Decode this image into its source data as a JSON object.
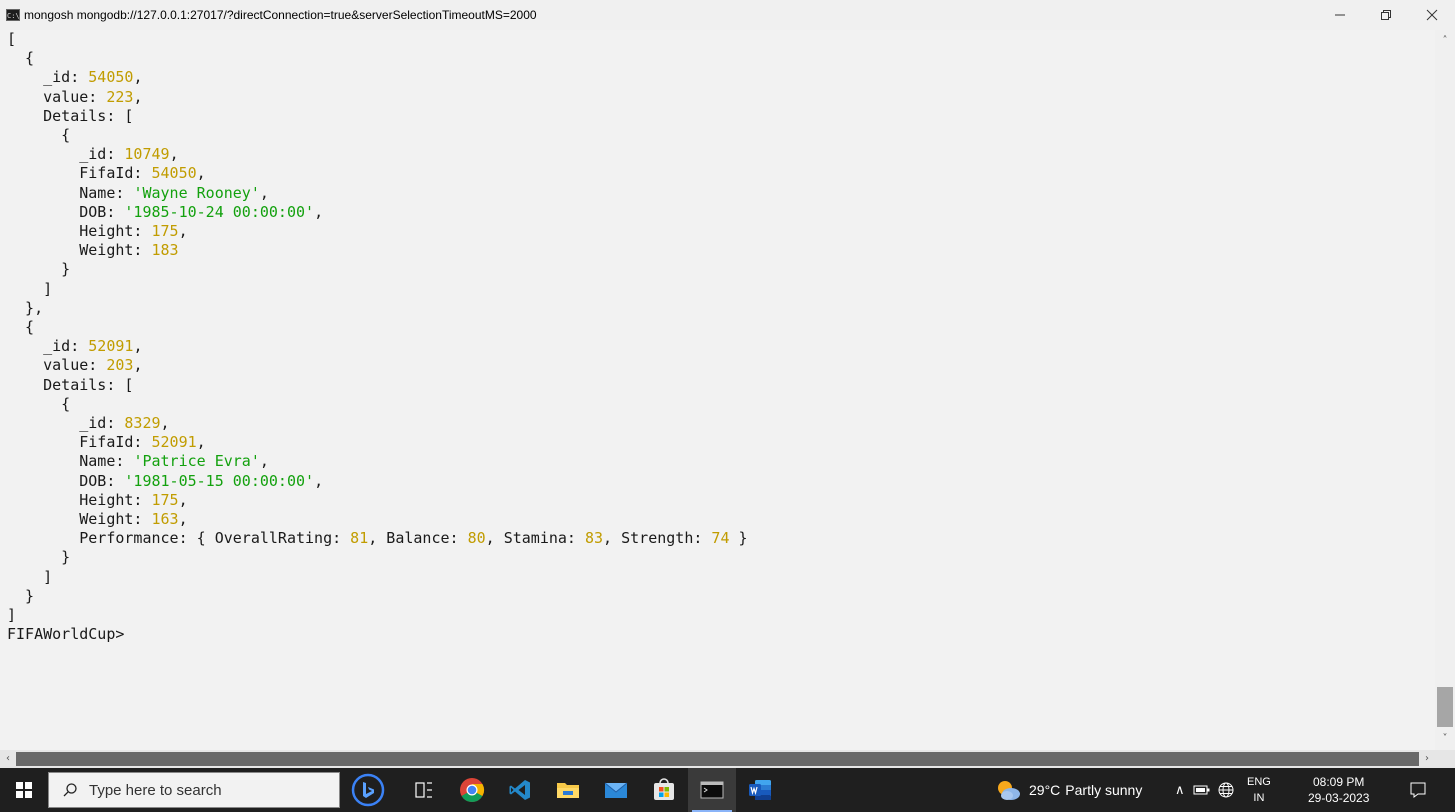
{
  "window": {
    "title": "mongosh mongodb://127.0.0.1:27017/?directConnection=true&serverSelectionTimeoutMS=2000",
    "app_icon_text": "C:\\"
  },
  "console": {
    "lines": [
      [
        {
          "t": "["
        }
      ],
      [
        {
          "t": "  {"
        }
      ],
      [
        {
          "t": "    _id: "
        },
        {
          "t": "54050",
          "c": "num"
        },
        {
          "t": ","
        }
      ],
      [
        {
          "t": "    value: "
        },
        {
          "t": "223",
          "c": "num"
        },
        {
          "t": ","
        }
      ],
      [
        {
          "t": "    Details: ["
        }
      ],
      [
        {
          "t": "      {"
        }
      ],
      [
        {
          "t": "        _id: "
        },
        {
          "t": "10749",
          "c": "num"
        },
        {
          "t": ","
        }
      ],
      [
        {
          "t": "        FifaId: "
        },
        {
          "t": "54050",
          "c": "num"
        },
        {
          "t": ","
        }
      ],
      [
        {
          "t": "        Name: "
        },
        {
          "t": "'Wayne Rooney'",
          "c": "str"
        },
        {
          "t": ","
        }
      ],
      [
        {
          "t": "        DOB: "
        },
        {
          "t": "'1985-10-24 00:00:00'",
          "c": "str"
        },
        {
          "t": ","
        }
      ],
      [
        {
          "t": "        Height: "
        },
        {
          "t": "175",
          "c": "num"
        },
        {
          "t": ","
        }
      ],
      [
        {
          "t": "        Weight: "
        },
        {
          "t": "183",
          "c": "num"
        }
      ],
      [
        {
          "t": "      }"
        }
      ],
      [
        {
          "t": "    ]"
        }
      ],
      [
        {
          "t": "  },"
        }
      ],
      [
        {
          "t": "  {"
        }
      ],
      [
        {
          "t": "    _id: "
        },
        {
          "t": "52091",
          "c": "num"
        },
        {
          "t": ","
        }
      ],
      [
        {
          "t": "    value: "
        },
        {
          "t": "203",
          "c": "num"
        },
        {
          "t": ","
        }
      ],
      [
        {
          "t": "    Details: ["
        }
      ],
      [
        {
          "t": "      {"
        }
      ],
      [
        {
          "t": "        _id: "
        },
        {
          "t": "8329",
          "c": "num"
        },
        {
          "t": ","
        }
      ],
      [
        {
          "t": "        FifaId: "
        },
        {
          "t": "52091",
          "c": "num"
        },
        {
          "t": ","
        }
      ],
      [
        {
          "t": "        Name: "
        },
        {
          "t": "'Patrice Evra'",
          "c": "str"
        },
        {
          "t": ","
        }
      ],
      [
        {
          "t": "        DOB: "
        },
        {
          "t": "'1981-05-15 00:00:00'",
          "c": "str"
        },
        {
          "t": ","
        }
      ],
      [
        {
          "t": "        Height: "
        },
        {
          "t": "175",
          "c": "num"
        },
        {
          "t": ","
        }
      ],
      [
        {
          "t": "        Weight: "
        },
        {
          "t": "163",
          "c": "num"
        },
        {
          "t": ","
        }
      ],
      [
        {
          "t": "        Performance: { OverallRating: "
        },
        {
          "t": "81",
          "c": "num"
        },
        {
          "t": ", Balance: "
        },
        {
          "t": "80",
          "c": "num"
        },
        {
          "t": ", Stamina: "
        },
        {
          "t": "83",
          "c": "num"
        },
        {
          "t": ", Strength: "
        },
        {
          "t": "74",
          "c": "num"
        },
        {
          "t": " }"
        }
      ],
      [
        {
          "t": "      }"
        }
      ],
      [
        {
          "t": "    ]"
        }
      ],
      [
        {
          "t": "  }"
        }
      ],
      [
        {
          "t": "]"
        }
      ],
      [
        {
          "t": "FIFAWorldCup>"
        }
      ]
    ]
  },
  "colors": {
    "number": "#c19c00",
    "string": "#13a10e",
    "console_bg": "#f2f2f2",
    "taskbar_bg": "#1f1f1f"
  },
  "taskbar": {
    "search_placeholder": "Type here to search",
    "pinned": [
      "bing-icon",
      "task-view-icon",
      "chrome-icon",
      "vscode-icon",
      "file-explorer-icon",
      "mail-icon",
      "store-icon",
      "terminal-icon",
      "word-icon"
    ],
    "weather": {
      "temp": "29°C",
      "condition": "Partly sunny"
    },
    "language": {
      "code": "ENG",
      "region": "IN"
    },
    "clock": {
      "time": "08:09 PM",
      "date": "29-03-2023"
    }
  }
}
